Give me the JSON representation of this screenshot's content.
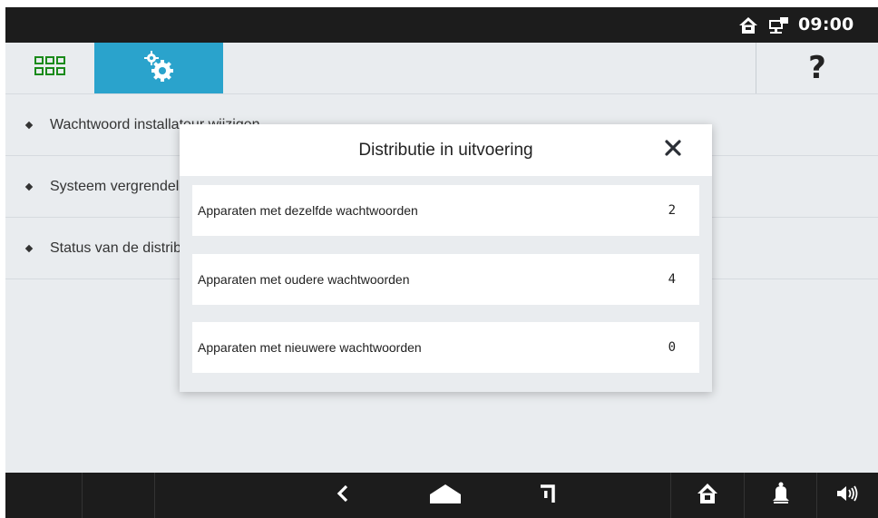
{
  "statusbar": {
    "time": "09:00",
    "icons": [
      "home-icon",
      "network-icon"
    ]
  },
  "toolbar": {
    "apps_icon": "grid-icon",
    "settings_icon": "gears-icon",
    "help_label": "?",
    "accent_color": "#2aa3cc"
  },
  "menu": {
    "items": [
      {
        "label": "Wachtwoord installateur wijzigen"
      },
      {
        "label": "Systeem vergrendelen"
      },
      {
        "label": "Status van de distributie"
      }
    ]
  },
  "modal": {
    "title": "Distributie in uitvoering",
    "close_icon": "close-icon",
    "rows": [
      {
        "label": "Apparaten met dezelfde wachtwoorden",
        "value": "2"
      },
      {
        "label": "Apparaten met oudere wachtwoorden",
        "value": "4"
      },
      {
        "label": "Apparaten met nieuwere wachtwoorden",
        "value": "0"
      }
    ]
  },
  "navbar": {
    "icons": [
      "back-icon",
      "home-shape-icon",
      "recent-icon",
      "house-icon",
      "bell-icon",
      "volume-icon"
    ]
  }
}
